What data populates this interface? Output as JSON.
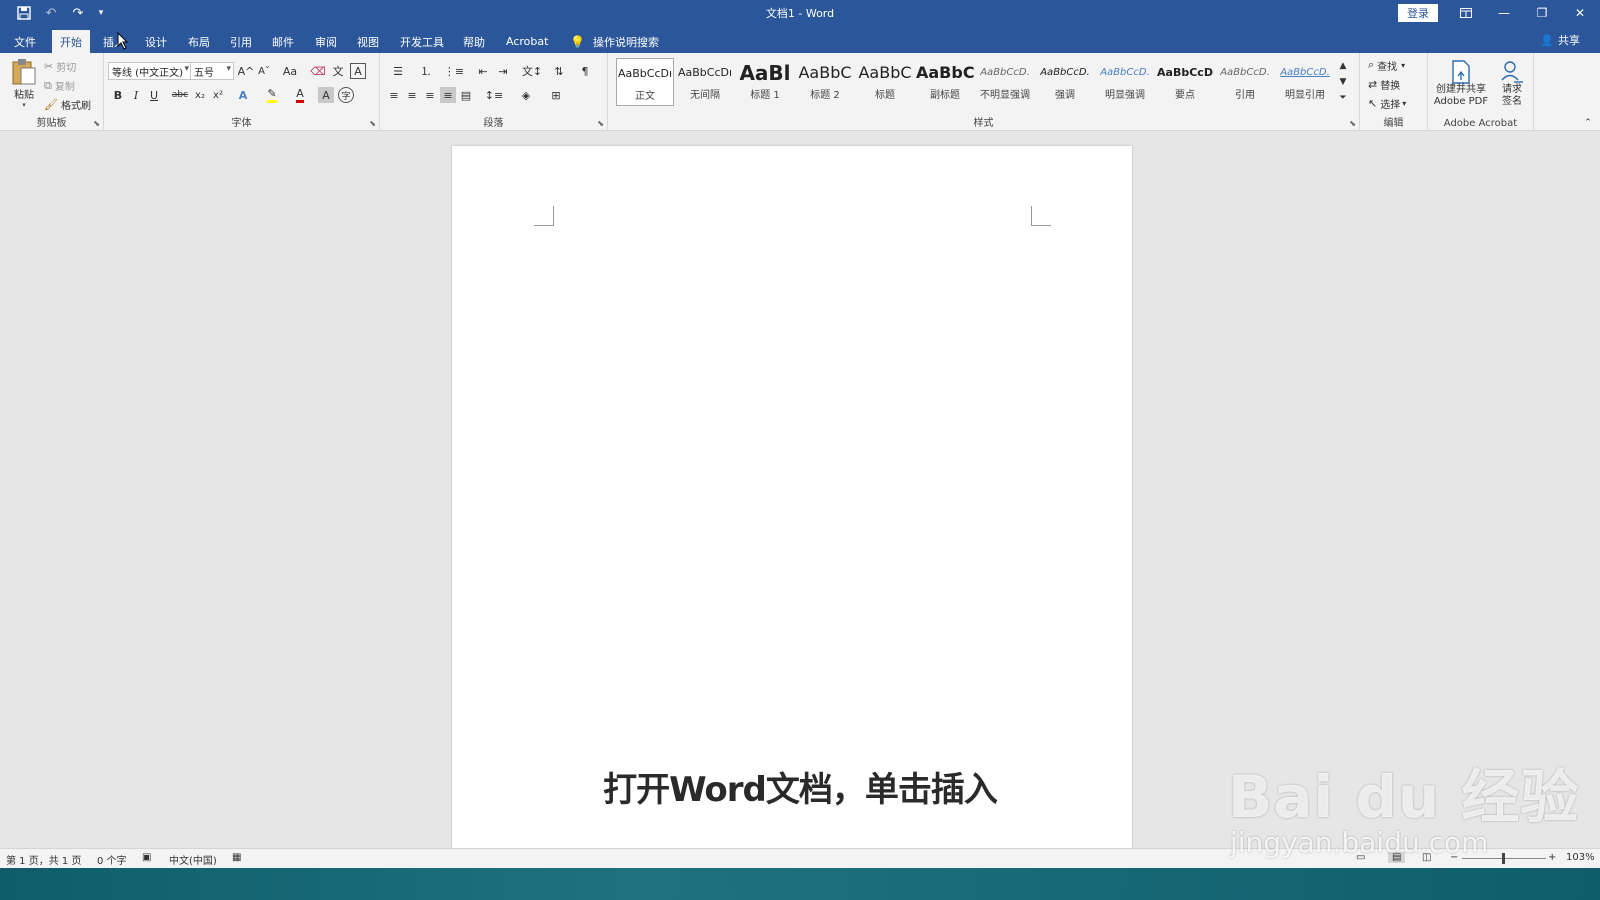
{
  "titlebar": {
    "title": "文档1  -  Word",
    "login": "登录",
    "icons": [
      "save-icon",
      "undo-icon",
      "redo-icon",
      "customize-qat-icon",
      "ribbon-display-options-icon",
      "minimize-icon",
      "restore-icon",
      "close-icon"
    ]
  },
  "tabs": [
    "文件",
    "开始",
    "插入",
    "设计",
    "布局",
    "引用",
    "邮件",
    "审阅",
    "视图",
    "开发工具",
    "帮助",
    "Acrobat"
  ],
  "active_tab": "开始",
  "tell_me": "操作说明搜索",
  "share": "共享",
  "clipboard": {
    "paste": "粘贴",
    "cut": "剪切",
    "copy": "复制",
    "format_painter": "格式刷",
    "label": "剪贴板"
  },
  "font": {
    "name": "等线 (中文正文)",
    "size": "五号",
    "label": "字体",
    "bold": "B",
    "italic": "I",
    "underline": "U",
    "strike": "abc",
    "subscript": "x₂",
    "superscript": "x²",
    "grow": "A^",
    "shrink": "Aˇ",
    "case": "Aa",
    "color_letter": "A",
    "highlight_color": "#ffff00",
    "font_color": "#d00000"
  },
  "paragraph": {
    "label": "段落"
  },
  "styles": {
    "label": "样式",
    "items": [
      {
        "sample": "AaBbCcDı",
        "name": "正文"
      },
      {
        "sample": "AaBbCcDı",
        "name": "无间隔"
      },
      {
        "sample": "AaBl",
        "name": "标题 1"
      },
      {
        "sample": "AaBbC",
        "name": "标题 2"
      },
      {
        "sample": "AaBbC",
        "name": "标题"
      },
      {
        "sample": "AaBbC",
        "name": "副标题"
      },
      {
        "sample": "AaBbCcD.",
        "name": "不明显强调"
      },
      {
        "sample": "AaBbCcD.",
        "name": "强调"
      },
      {
        "sample": "AaBbCcD.",
        "name": "明显强调"
      },
      {
        "sample": "AaBbCcD",
        "name": "要点"
      },
      {
        "sample": "AaBbCcD.",
        "name": "引用"
      },
      {
        "sample": "AaBbCcD.",
        "name": "明显引用"
      }
    ]
  },
  "editing": {
    "find": "查找",
    "replace": "替换",
    "select": "选择",
    "label": "编辑"
  },
  "acrobat": {
    "create_pdf_line1": "创建并共享",
    "create_pdf_line2": "Adobe PDF",
    "request_sign_line1": "请求",
    "request_sign_line2": "签名",
    "label": "Adobe Acrobat"
  },
  "document": {
    "caption": "打开Word文档，单击插入"
  },
  "status": {
    "page": "第 1 页，共 1 页",
    "words": "0 个字",
    "language": "中文(中国)",
    "zoom": "103%",
    "zoom_minus": "−",
    "zoom_plus": "+"
  },
  "watermark": {
    "logo": "Bai du 经验",
    "url": "jingyan.baidu.com"
  }
}
